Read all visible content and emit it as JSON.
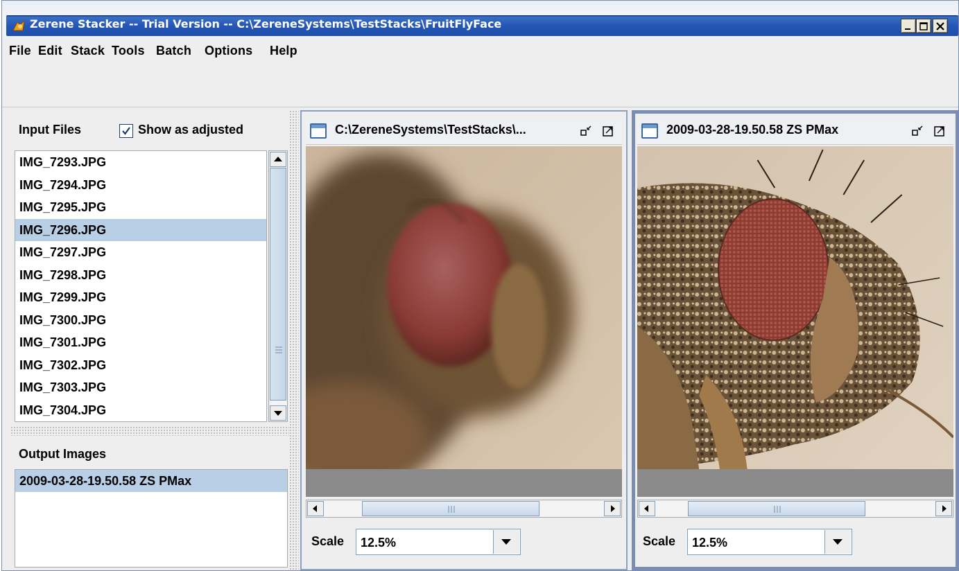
{
  "window": {
    "title": "Zerene Stacker -- Trial Version -- C:\\ZereneSystems\\TestStacks\\FruitFlyFace"
  },
  "menu": {
    "items": [
      "File",
      "Edit",
      "Stack",
      "Tools",
      "Batch",
      "Options",
      "Help"
    ]
  },
  "input_panel": {
    "label": "Input Files",
    "show_adjusted_label": "Show as adjusted",
    "show_adjusted_checked": true,
    "files": [
      "IMG_7293.JPG",
      "IMG_7294.JPG",
      "IMG_7295.JPG",
      "IMG_7296.JPG",
      "IMG_7297.JPG",
      "IMG_7298.JPG",
      "IMG_7299.JPG",
      "IMG_7300.JPG",
      "IMG_7301.JPG",
      "IMG_7302.JPG",
      "IMG_7303.JPG",
      "IMG_7304.JPG"
    ],
    "selected_file": "IMG_7296.JPG"
  },
  "output_panel": {
    "label": "Output Images",
    "items": [
      "2009-03-28-19.50.58 ZS PMax"
    ],
    "selected_item": "2009-03-28-19.50.58 ZS PMax"
  },
  "frames": {
    "left": {
      "title": "C:\\ZereneSystems\\TestStacks\\...",
      "scale_label": "Scale",
      "scale_value": "12.5%"
    },
    "right": {
      "title": "2009-03-28-19.50.58 ZS PMax",
      "scale_label": "Scale",
      "scale_value": "12.5%"
    }
  },
  "icons": {
    "app": "zerene-app-icon",
    "minimize": "minimize-icon",
    "maximize": "maximize-icon",
    "close": "close-icon",
    "frame": "frame-window-icon",
    "frame_restore": "restore-down-icon",
    "frame_maximize": "maximize-frame-icon"
  },
  "colors": {
    "selection": "#b8cfe5",
    "titlebar": "#2457b8",
    "frame_active_border": "#7a8eb3"
  }
}
